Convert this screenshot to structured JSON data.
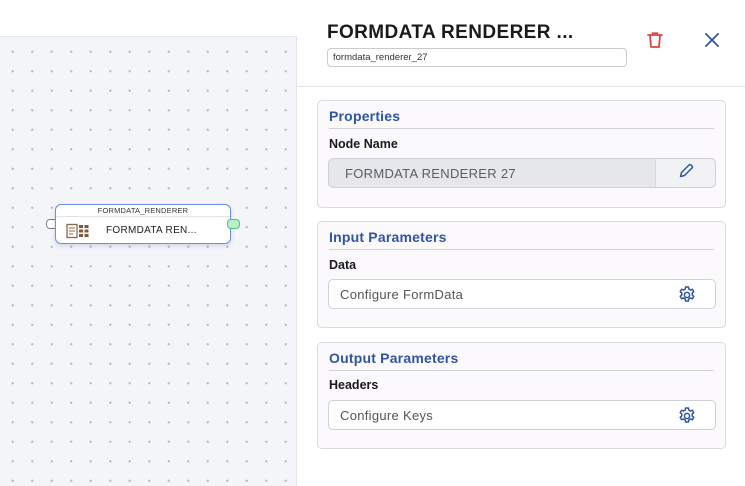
{
  "canvas": {
    "node": {
      "type_label": "FORMDATA_RENDERER",
      "name_label": "FORMDATA REN..."
    }
  },
  "panel": {
    "title": "FORMDATA RENDERER ...",
    "node_id_value": "formdata_renderer_27",
    "properties": {
      "title": "Properties",
      "node_name_label": "Node Name",
      "node_name_value": "FORMDATA RENDERER 27"
    },
    "input_parameters": {
      "title": "Input Parameters",
      "data_label": "Data",
      "data_value": "Configure FormData"
    },
    "output_parameters": {
      "title": "Output Parameters",
      "headers_label": "Headers",
      "headers_value": "Configure Keys"
    }
  },
  "colors": {
    "accent": "#2f55a4",
    "delete": "#d64545",
    "node_border": "#6b8fe6",
    "output_port": "#4cc27a"
  },
  "icons": [
    "formdata-icon",
    "trash-icon",
    "close-icon",
    "pencil-icon",
    "gear-icon"
  ]
}
